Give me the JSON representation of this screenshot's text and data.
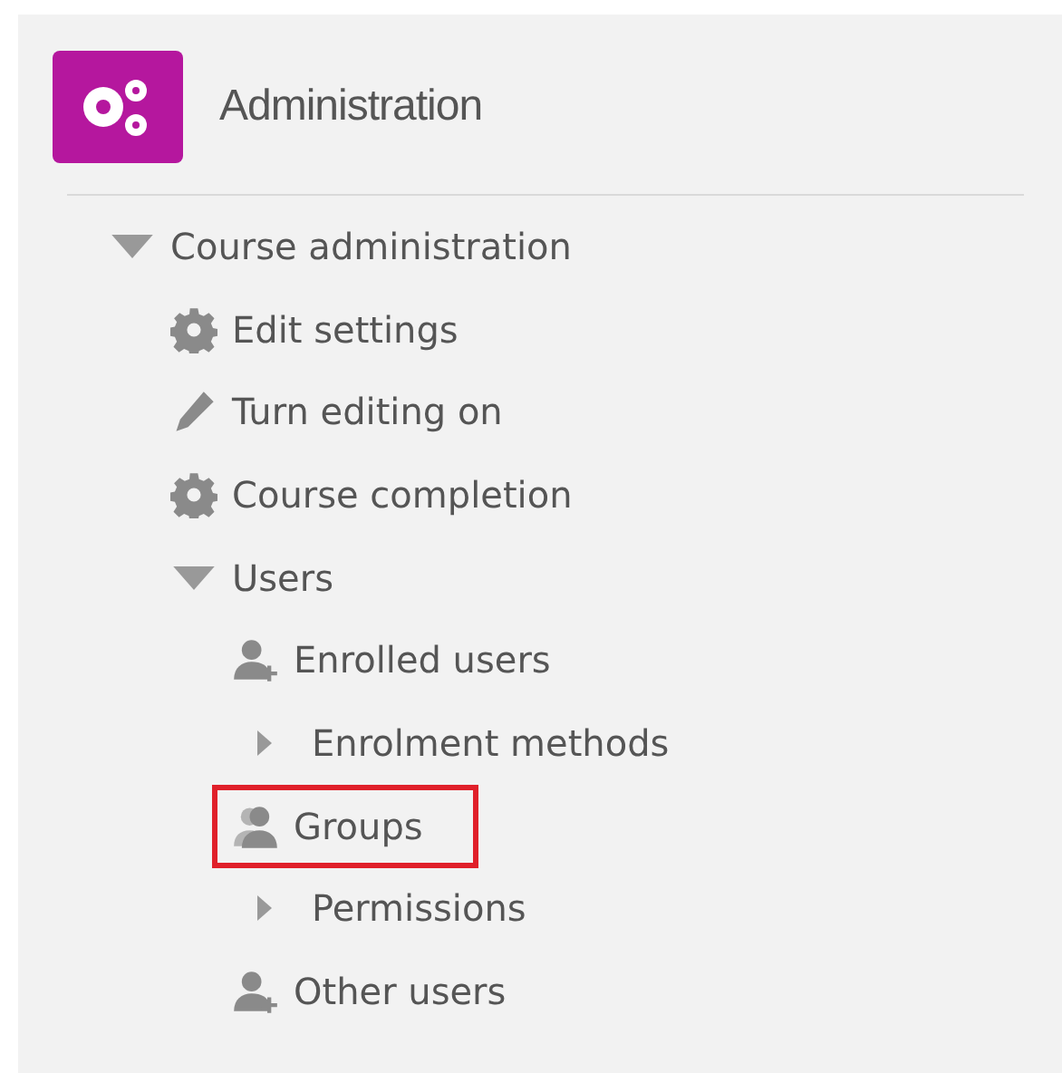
{
  "block": {
    "title": "Administration"
  },
  "tree": [
    {
      "label": "Course administration",
      "kind": "branch",
      "expanded": true,
      "children": [
        {
          "label": "Edit settings",
          "kind": "gear"
        },
        {
          "label": "Turn editing on",
          "kind": "pencil"
        },
        {
          "label": "Course completion",
          "kind": "gear"
        },
        {
          "label": "Users",
          "kind": "branch",
          "expanded": true,
          "children": [
            {
              "label": "Enrolled users",
              "kind": "user-add",
              "highlighted": false
            },
            {
              "label": "Enrolment methods",
              "kind": "branch",
              "expanded": false
            },
            {
              "label": "Groups",
              "kind": "group",
              "highlighted": true
            },
            {
              "label": "Permissions",
              "kind": "branch",
              "expanded": false
            },
            {
              "label": "Other users",
              "kind": "user-add",
              "highlighted": false
            }
          ]
        }
      ]
    }
  ]
}
